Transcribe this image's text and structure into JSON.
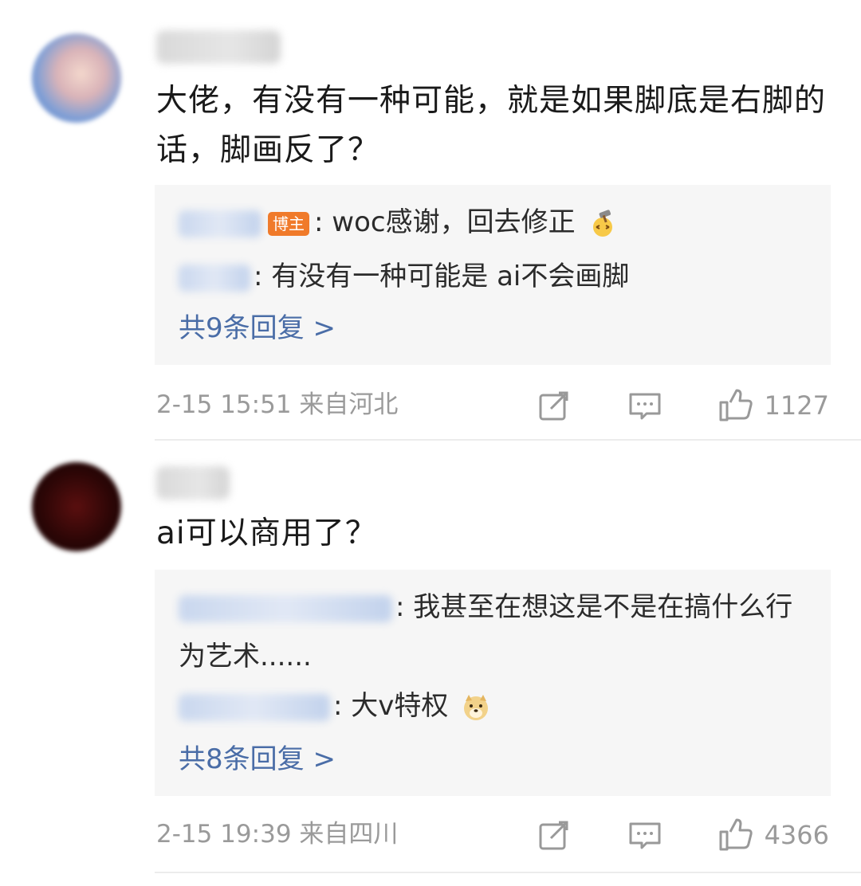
{
  "comments": [
    {
      "text": "大佬，有没有一种可能，就是如果脚底是右脚的话，脚画反了？",
      "replies": [
        {
          "badge": "博主",
          "text": ": woc感谢，回去修正",
          "emoji": "hammer-face-emoji"
        },
        {
          "text": ": 有没有一种可能是 ai不会画脚"
        }
      ],
      "more_replies": "共9条回复 >",
      "timestamp": "2-15 15:51",
      "location": "来自河北",
      "likes": "1127"
    },
    {
      "text": "ai可以商用了？",
      "replies": [
        {
          "text": ": 我甚至在想这是不是在搞什么行为艺术......"
        },
        {
          "text": ": 大v特权",
          "emoji": "doge-emoji"
        }
      ],
      "more_replies": "共8条回复 >",
      "timestamp": "2-15 19:39",
      "location": "来自四川",
      "likes": "4366"
    }
  ],
  "icons": {
    "share": "share-icon",
    "reply": "comment-icon",
    "like": "thumbs-up-icon"
  },
  "colors": {
    "link": "#4a6da7",
    "badge": "#f07a2a",
    "meta": "#9a9a9a",
    "reply_bg": "#f6f6f6"
  }
}
